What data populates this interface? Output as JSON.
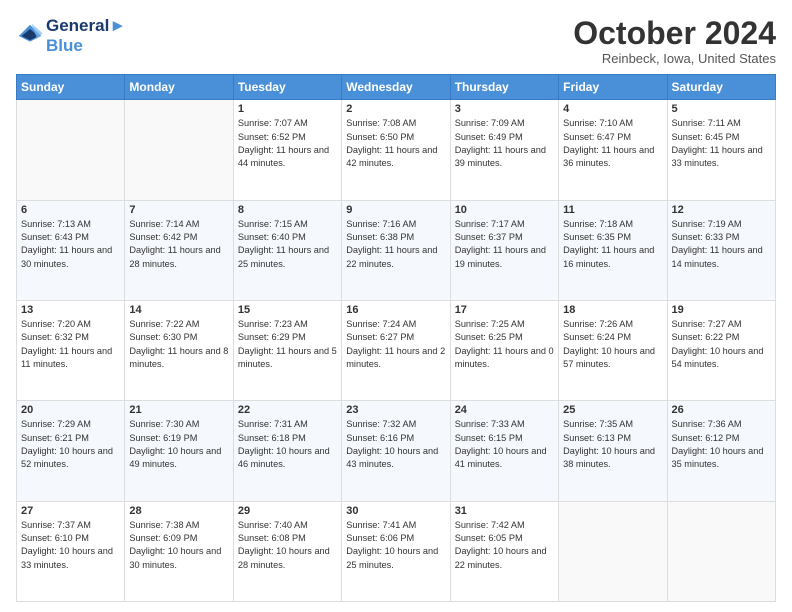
{
  "header": {
    "logo_line1": "General",
    "logo_line2": "Blue",
    "month": "October 2024",
    "location": "Reinbeck, Iowa, United States"
  },
  "days_of_week": [
    "Sunday",
    "Monday",
    "Tuesday",
    "Wednesday",
    "Thursday",
    "Friday",
    "Saturday"
  ],
  "weeks": [
    [
      {
        "day": "",
        "info": ""
      },
      {
        "day": "",
        "info": ""
      },
      {
        "day": "1",
        "info": "Sunrise: 7:07 AM\nSunset: 6:52 PM\nDaylight: 11 hours and 44 minutes."
      },
      {
        "day": "2",
        "info": "Sunrise: 7:08 AM\nSunset: 6:50 PM\nDaylight: 11 hours and 42 minutes."
      },
      {
        "day": "3",
        "info": "Sunrise: 7:09 AM\nSunset: 6:49 PM\nDaylight: 11 hours and 39 minutes."
      },
      {
        "day": "4",
        "info": "Sunrise: 7:10 AM\nSunset: 6:47 PM\nDaylight: 11 hours and 36 minutes."
      },
      {
        "day": "5",
        "info": "Sunrise: 7:11 AM\nSunset: 6:45 PM\nDaylight: 11 hours and 33 minutes."
      }
    ],
    [
      {
        "day": "6",
        "info": "Sunrise: 7:13 AM\nSunset: 6:43 PM\nDaylight: 11 hours and 30 minutes."
      },
      {
        "day": "7",
        "info": "Sunrise: 7:14 AM\nSunset: 6:42 PM\nDaylight: 11 hours and 28 minutes."
      },
      {
        "day": "8",
        "info": "Sunrise: 7:15 AM\nSunset: 6:40 PM\nDaylight: 11 hours and 25 minutes."
      },
      {
        "day": "9",
        "info": "Sunrise: 7:16 AM\nSunset: 6:38 PM\nDaylight: 11 hours and 22 minutes."
      },
      {
        "day": "10",
        "info": "Sunrise: 7:17 AM\nSunset: 6:37 PM\nDaylight: 11 hours and 19 minutes."
      },
      {
        "day": "11",
        "info": "Sunrise: 7:18 AM\nSunset: 6:35 PM\nDaylight: 11 hours and 16 minutes."
      },
      {
        "day": "12",
        "info": "Sunrise: 7:19 AM\nSunset: 6:33 PM\nDaylight: 11 hours and 14 minutes."
      }
    ],
    [
      {
        "day": "13",
        "info": "Sunrise: 7:20 AM\nSunset: 6:32 PM\nDaylight: 11 hours and 11 minutes."
      },
      {
        "day": "14",
        "info": "Sunrise: 7:22 AM\nSunset: 6:30 PM\nDaylight: 11 hours and 8 minutes."
      },
      {
        "day": "15",
        "info": "Sunrise: 7:23 AM\nSunset: 6:29 PM\nDaylight: 11 hours and 5 minutes."
      },
      {
        "day": "16",
        "info": "Sunrise: 7:24 AM\nSunset: 6:27 PM\nDaylight: 11 hours and 2 minutes."
      },
      {
        "day": "17",
        "info": "Sunrise: 7:25 AM\nSunset: 6:25 PM\nDaylight: 11 hours and 0 minutes."
      },
      {
        "day": "18",
        "info": "Sunrise: 7:26 AM\nSunset: 6:24 PM\nDaylight: 10 hours and 57 minutes."
      },
      {
        "day": "19",
        "info": "Sunrise: 7:27 AM\nSunset: 6:22 PM\nDaylight: 10 hours and 54 minutes."
      }
    ],
    [
      {
        "day": "20",
        "info": "Sunrise: 7:29 AM\nSunset: 6:21 PM\nDaylight: 10 hours and 52 minutes."
      },
      {
        "day": "21",
        "info": "Sunrise: 7:30 AM\nSunset: 6:19 PM\nDaylight: 10 hours and 49 minutes."
      },
      {
        "day": "22",
        "info": "Sunrise: 7:31 AM\nSunset: 6:18 PM\nDaylight: 10 hours and 46 minutes."
      },
      {
        "day": "23",
        "info": "Sunrise: 7:32 AM\nSunset: 6:16 PM\nDaylight: 10 hours and 43 minutes."
      },
      {
        "day": "24",
        "info": "Sunrise: 7:33 AM\nSunset: 6:15 PM\nDaylight: 10 hours and 41 minutes."
      },
      {
        "day": "25",
        "info": "Sunrise: 7:35 AM\nSunset: 6:13 PM\nDaylight: 10 hours and 38 minutes."
      },
      {
        "day": "26",
        "info": "Sunrise: 7:36 AM\nSunset: 6:12 PM\nDaylight: 10 hours and 35 minutes."
      }
    ],
    [
      {
        "day": "27",
        "info": "Sunrise: 7:37 AM\nSunset: 6:10 PM\nDaylight: 10 hours and 33 minutes."
      },
      {
        "day": "28",
        "info": "Sunrise: 7:38 AM\nSunset: 6:09 PM\nDaylight: 10 hours and 30 minutes."
      },
      {
        "day": "29",
        "info": "Sunrise: 7:40 AM\nSunset: 6:08 PM\nDaylight: 10 hours and 28 minutes."
      },
      {
        "day": "30",
        "info": "Sunrise: 7:41 AM\nSunset: 6:06 PM\nDaylight: 10 hours and 25 minutes."
      },
      {
        "day": "31",
        "info": "Sunrise: 7:42 AM\nSunset: 6:05 PM\nDaylight: 10 hours and 22 minutes."
      },
      {
        "day": "",
        "info": ""
      },
      {
        "day": "",
        "info": ""
      }
    ]
  ]
}
